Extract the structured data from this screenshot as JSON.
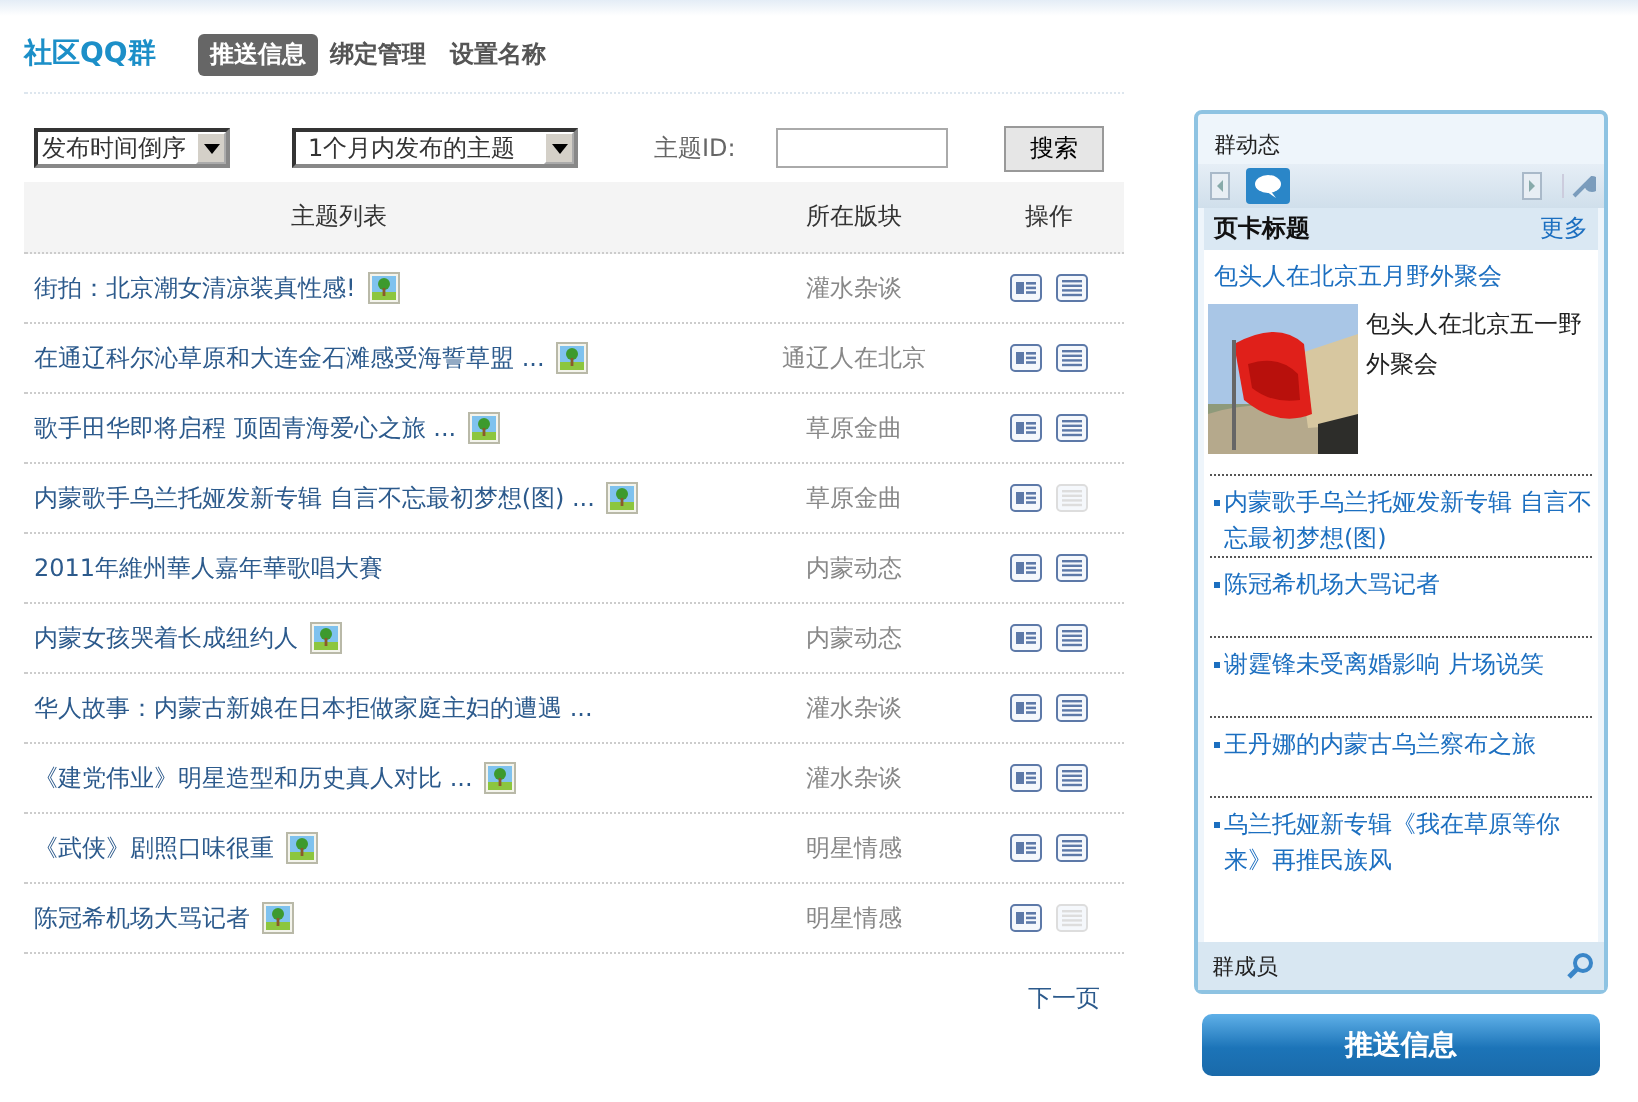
{
  "header": {
    "logo": "社区QQ群",
    "tabs": [
      {
        "label": "推送信息",
        "selected": true
      },
      {
        "label": "绑定管理",
        "selected": false
      },
      {
        "label": "设置名称",
        "selected": false
      }
    ]
  },
  "filters": {
    "sort": "发布时间倒序",
    "range": "1个月内发布的主题",
    "id_label": "主题ID:",
    "search_button": "搜索"
  },
  "table": {
    "columns": [
      "主题列表",
      "所在版块",
      "操作"
    ],
    "rows": [
      {
        "title": "街拍：北京潮女清凉装真性感!",
        "has_image": true,
        "board": "灌水杂谈",
        "list_enabled": true
      },
      {
        "title": "在通辽科尔沁草原和大连金石滩感受海誓草盟 ...",
        "has_image": true,
        "board": "通辽人在北京",
        "list_enabled": true
      },
      {
        "title": "歌手田华即将启程  顶固青海爱心之旅 ...",
        "has_image": true,
        "board": "草原金曲",
        "list_enabled": true
      },
      {
        "title": "内蒙歌手乌兰托娅发新专辑  自言不忘最初梦想(图) ...",
        "has_image": true,
        "board": "草原金曲",
        "list_enabled": false
      },
      {
        "title": "2011年維州華人嘉年華歌唱大賽",
        "has_image": false,
        "board": "内蒙动态",
        "list_enabled": true
      },
      {
        "title": "内蒙女孩哭着长成纽约人",
        "has_image": true,
        "board": "内蒙动态",
        "list_enabled": true
      },
      {
        "title": "华人故事：内蒙古新娘在日本拒做家庭主妇的遭遇 ...",
        "has_image": false,
        "board": "灌水杂谈",
        "list_enabled": true
      },
      {
        "title": "《建党伟业》明星造型和历史真人对比 ...",
        "has_image": true,
        "board": "灌水杂谈",
        "list_enabled": true
      },
      {
        "title": "《武侠》剧照口味很重",
        "has_image": true,
        "board": "明星情感",
        "list_enabled": true
      },
      {
        "title": "陈冠希机场大骂记者",
        "has_image": true,
        "board": "明星情感",
        "list_enabled": false
      }
    ]
  },
  "pager": {
    "next": "下一页"
  },
  "sidebar": {
    "title": "群动态",
    "card_title": "页卡标题",
    "more": "更多",
    "featured": {
      "title": "包头人在北京五月野外聚会",
      "caption": "包头人在北京五一野外聚会"
    },
    "items": [
      "内蒙歌手乌兰托娅发新专辑  自言不忘最初梦想(图)",
      "陈冠希机场大骂记者",
      "谢霆锋未受离婚影响    片场说笑",
      "王丹娜的内蒙古乌兰察布之旅",
      "乌兰托娅新专辑《我在草原等你来》再推民族风"
    ],
    "footer": "群成员"
  },
  "push_button": "推送信息"
}
